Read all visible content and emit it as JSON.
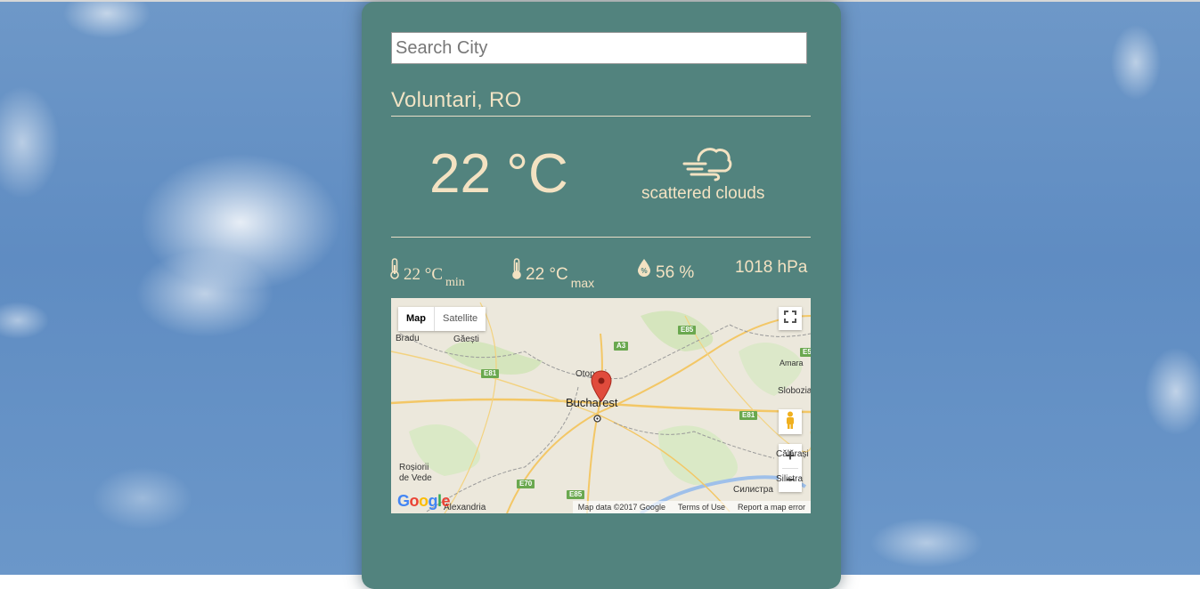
{
  "search": {
    "placeholder": "Search City",
    "value": ""
  },
  "location": {
    "city": "Voluntari, RO"
  },
  "current": {
    "temperature": "22 °C",
    "description": "scattered clouds",
    "icon": "wind-clouds-icon"
  },
  "stats": {
    "min_value": "22 °C",
    "min_label": "min",
    "max_value": "22 °C",
    "max_label": "max",
    "humidity": "56 %",
    "pressure": "1018 hPa"
  },
  "map": {
    "type_map": "Map",
    "type_satellite": "Satellite",
    "labels": {
      "bucharest": "Bucharest",
      "gaesti": "Găești",
      "bradu": "Bradu",
      "otopeni": "Otopeni",
      "amara": "Amara",
      "slobozia": "Slobozia",
      "rosiorii": "Roșiorii",
      "de_vede": "de Vede",
      "alexandria": "Alexandria",
      "calarasi": "Călărași",
      "silistra": "Silistra",
      "silistra_bg": "Силистра"
    },
    "roads": {
      "a3": "A3",
      "e85": "E85",
      "e81": "E81",
      "e81b": "E81",
      "e70": "E70",
      "e85b": "E85",
      "e5": "E5"
    },
    "footer": {
      "data": "Map data ©2017 Google",
      "terms": "Terms of Use",
      "report": "Report a map error"
    },
    "logo": "Google"
  },
  "colors": {
    "card": "#52837e",
    "text": "#f3e2c2",
    "marker": "#e04b3c"
  }
}
